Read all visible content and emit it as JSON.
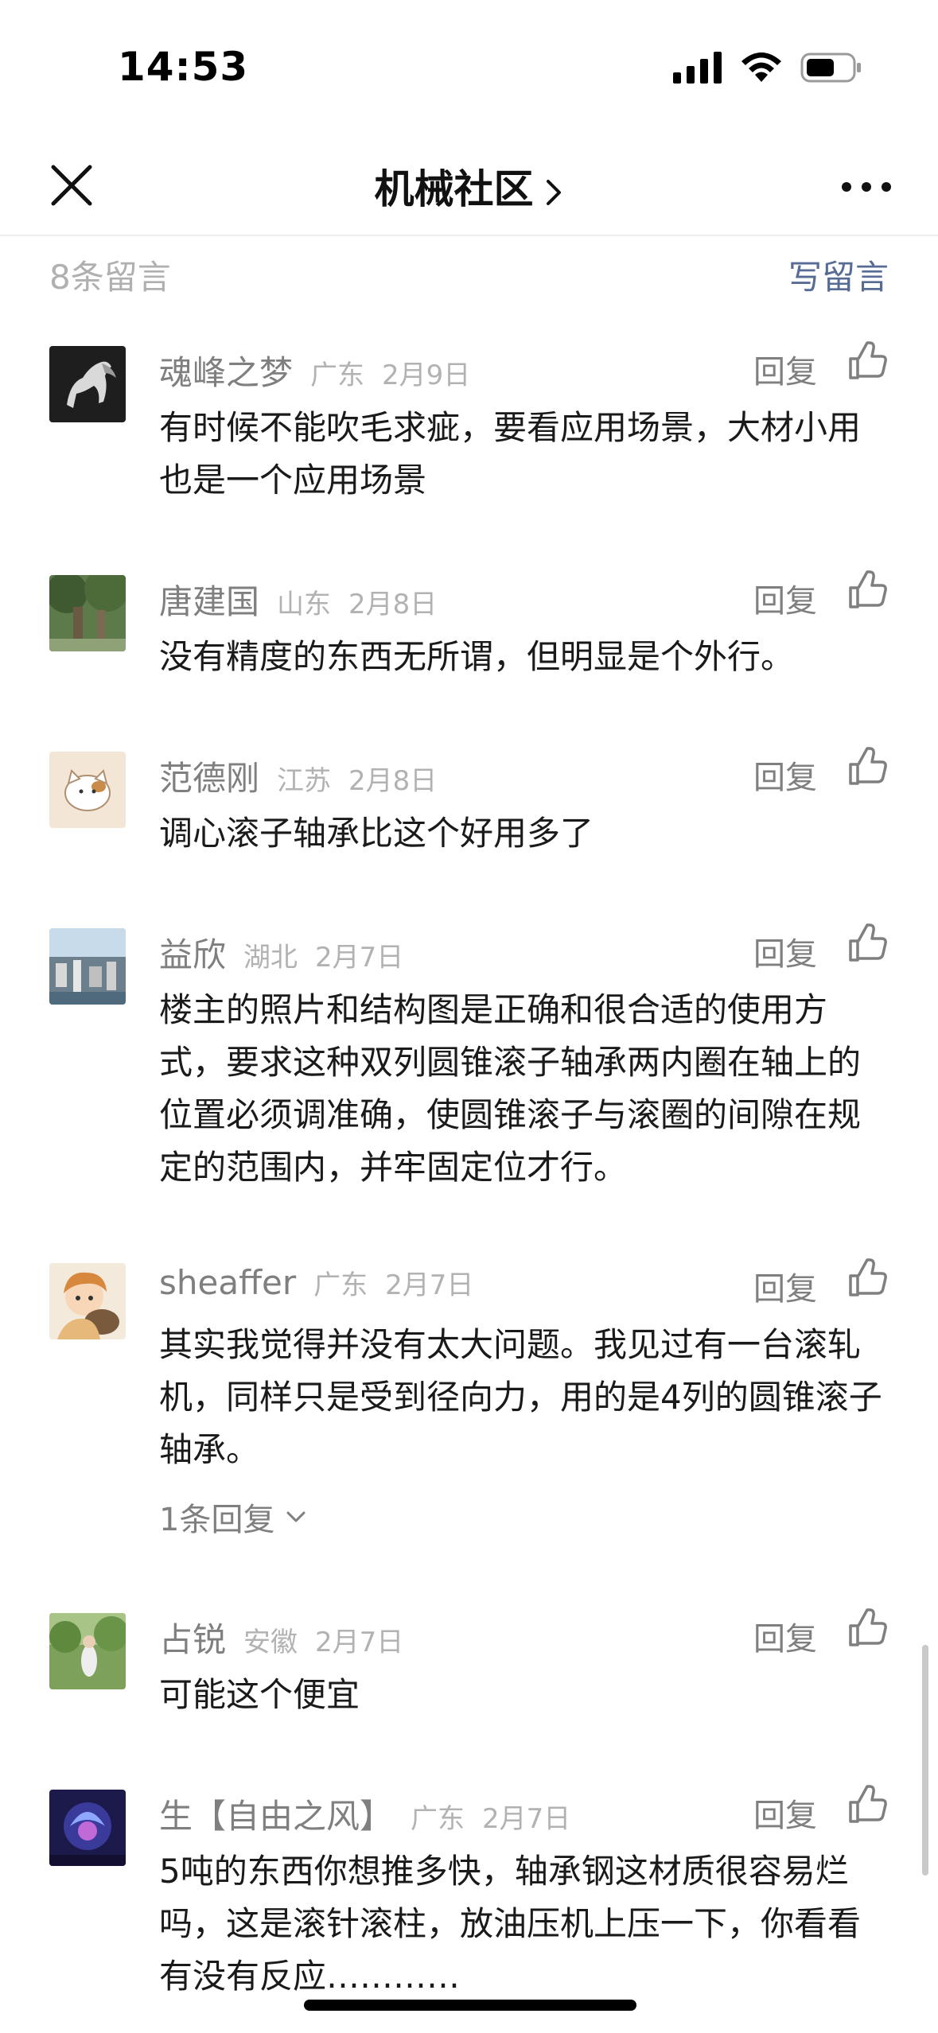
{
  "status": {
    "time": "14:53"
  },
  "nav": {
    "title": "机械社区"
  },
  "header": {
    "count": "8条留言",
    "write": "写留言"
  },
  "reply_label": "回复",
  "comments": [
    {
      "name": "魂峰之梦",
      "loc": "广东",
      "date": "2月9日",
      "text": "有时候不能吹毛求疵，要看应用场景，大材小用也是一个应用场景"
    },
    {
      "name": "唐建国",
      "loc": "山东",
      "date": "2月8日",
      "text": "没有精度的东西无所谓，但明显是个外行。"
    },
    {
      "name": "范德刚",
      "loc": "江苏",
      "date": "2月8日",
      "text": "调心滚子轴承比这个好用多了"
    },
    {
      "name": "益欣",
      "loc": "湖北",
      "date": "2月7日",
      "text": "楼主的照片和结构图是正确和很合适的使用方式，要求这种双列圆锥滚子轴承两内圈在轴上的位置必须调准确，使圆锥滚子与滚圈的间隙在规定的范围内，并牢固定位才行。"
    },
    {
      "name": "sheaffer",
      "loc": "广东",
      "date": "2月7日",
      "text": "其实我觉得并没有太大问题。我见过有一台滚轧机，同样只是受到径向力，用的是4列的圆锥滚子轴承。",
      "sub_replies": "1条回复"
    },
    {
      "name": "占锐",
      "loc": "安徽",
      "date": "2月7日",
      "text": "可能这个便宜"
    },
    {
      "name": "生【自由之风】",
      "loc": "广东",
      "date": "2月7日",
      "text": "5吨的东西你想推多快，轴承钢这材质很容易烂吗，这是滚针滚柱，放油压机上压一下，你看看有没有反应…………"
    }
  ]
}
